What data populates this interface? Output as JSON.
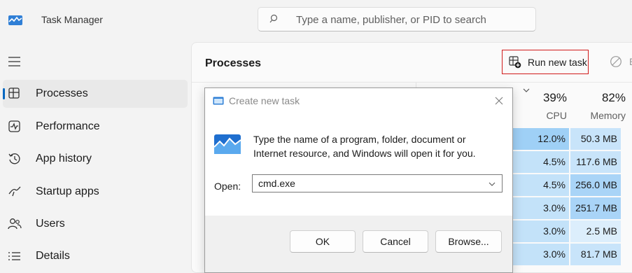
{
  "app": {
    "title": "Task Manager",
    "icon": "task-manager-icon"
  },
  "search": {
    "placeholder": "Type a name, publisher, or PID to search"
  },
  "sidebar": {
    "items": [
      {
        "label": "Processes",
        "icon": "processes-icon",
        "active": true
      },
      {
        "label": "Performance",
        "icon": "performance-icon",
        "active": false
      },
      {
        "label": "App history",
        "icon": "app-history-icon",
        "active": false
      },
      {
        "label": "Startup apps",
        "icon": "startup-apps-icon",
        "active": false
      },
      {
        "label": "Users",
        "icon": "users-icon",
        "active": false
      },
      {
        "label": "Details",
        "icon": "details-icon",
        "active": false
      }
    ]
  },
  "main": {
    "title": "Processes",
    "run_new_task": "Run new task",
    "end_task_partial": "E",
    "columns": {
      "cpu": {
        "percent": "39%",
        "label": "CPU"
      },
      "memory": {
        "percent": "82%",
        "label": "Memory"
      }
    },
    "rows": [
      {
        "cpu": "12.0%",
        "memory": "50.3 MB"
      },
      {
        "cpu": "4.5%",
        "memory": "117.6 MB"
      },
      {
        "cpu": "4.5%",
        "memory": "256.0 MB"
      },
      {
        "cpu": "3.0%",
        "memory": "251.7 MB"
      },
      {
        "cpu": "3.0%",
        "memory": "2.5 MB"
      },
      {
        "cpu": "3.0%",
        "memory": "81.7 MB"
      }
    ]
  },
  "dialog": {
    "title": "Create new task",
    "line1": "Type the name of a program, folder, document or",
    "line2": "Internet resource, and Windows will open it for you.",
    "open_label": "Open:",
    "open_value": "cmd.exe",
    "ok": "OK",
    "cancel": "Cancel",
    "browse": "Browse..."
  },
  "colors": {
    "accent": "#0067c0",
    "highlight_border": "#d11b1b",
    "cpu_heat": "#9fd0f6",
    "memory_heat": "#c8e4fa"
  }
}
